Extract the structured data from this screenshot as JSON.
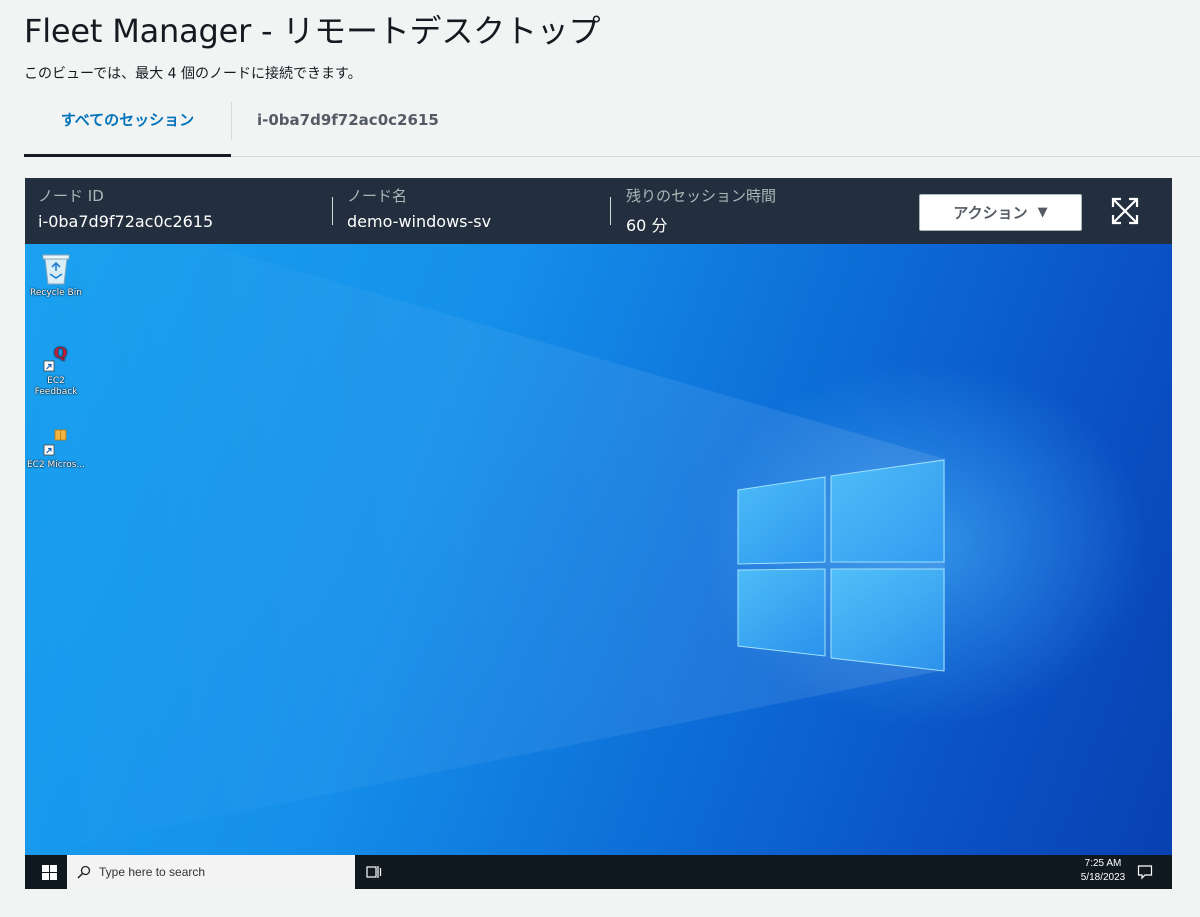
{
  "page": {
    "title": "Fleet Manager - リモートデスクトップ",
    "subtitle": "このビューでは、最大 4 個のノードに接続できます。"
  },
  "tabs": [
    {
      "label": "すべてのセッション",
      "active": true
    },
    {
      "label": "i-0ba7d9f72ac0c2615",
      "active": false
    }
  ],
  "session": {
    "node_id_label": "ノード ID",
    "node_id": "i-0ba7d9f72ac0c2615",
    "node_name_label": "ノード名",
    "node_name": "demo-windows-sv",
    "remaining_label": "残りのセッション時間",
    "remaining": "60 分",
    "action_label": "アクション",
    "expand_icon": "fullscreen-expand-icon"
  },
  "desktop": {
    "icons": [
      {
        "label": "Recycle Bin",
        "icon": "recycle-bin-icon"
      },
      {
        "label": "EC2 Feedback",
        "icon": "feedback-shortcut-icon"
      },
      {
        "label": "EC2 Micros...",
        "icon": "package-shortcut-icon"
      }
    ]
  },
  "taskbar": {
    "search_placeholder": "Type here to search",
    "time": "7:25 AM",
    "date": "5/18/2023"
  },
  "colors": {
    "header_bg": "#232f3e",
    "tab_active": "#0073bb",
    "taskbar_bg": "#101820"
  }
}
